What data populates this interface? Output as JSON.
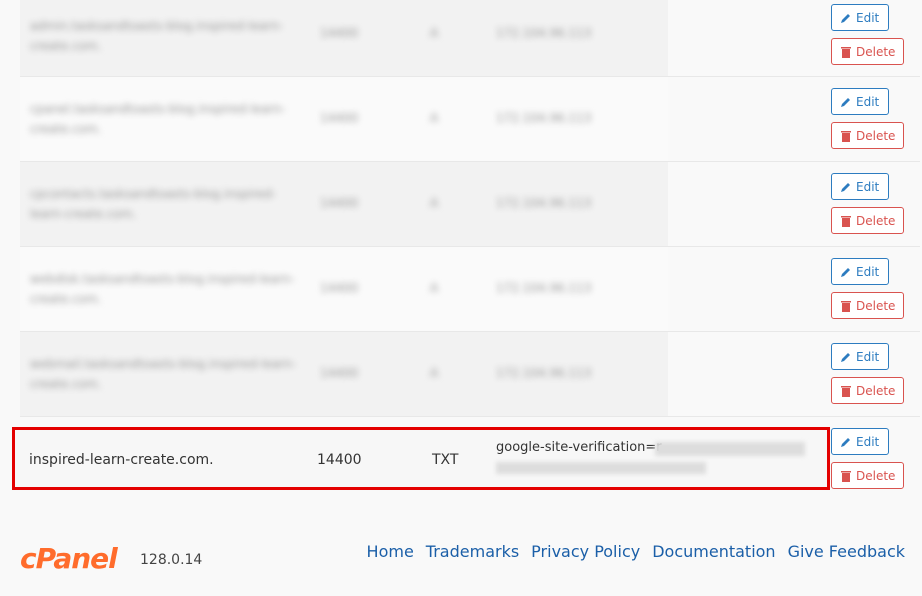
{
  "rows": [
    {
      "name": "admin.tasksandtoasts-blog.inspired-learn-create.com.",
      "ttl": "14400",
      "type": "A",
      "record": "172.104.96.113"
    },
    {
      "name": "cpanel.tasksandtoasts-blog.inspired-learn-create.com.",
      "ttl": "14400",
      "type": "A",
      "record": "172.104.96.113"
    },
    {
      "name": "cpcontacts.tasksandtoasts-blog.inspired-learn-create.com.",
      "ttl": "14400",
      "type": "A",
      "record": "172.104.96.113"
    },
    {
      "name": "webdisk.tasksandtoasts-blog.inspired-learn-create.com.",
      "ttl": "14400",
      "type": "A",
      "record": "172.104.96.113"
    },
    {
      "name": "webmail.tasksandtoasts-blog.inspired-learn-create.com.",
      "ttl": "14400",
      "type": "A",
      "record": "172.104.96.113"
    }
  ],
  "highlighted": {
    "name": "inspired-learn-create.com.",
    "ttl": "14400",
    "type": "TXT",
    "record": "google-site-verification=r"
  },
  "buttons": {
    "edit": "Edit",
    "delete": "Delete"
  },
  "footer": {
    "brand": "cPanel",
    "version": "128.0.14",
    "links": [
      "Home",
      "Trademarks",
      "Privacy Policy",
      "Documentation",
      "Give Feedback"
    ]
  },
  "colors": {
    "edit": "#2d7cc0",
    "delete": "#d9534f",
    "highlight": "#e40000",
    "brand": "#ff6c2c"
  }
}
